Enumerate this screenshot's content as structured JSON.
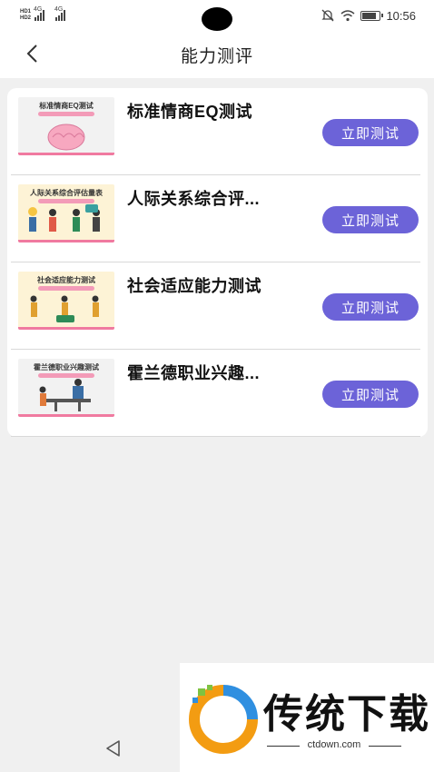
{
  "status_bar": {
    "net1": "HD1",
    "net2": "HD2",
    "sig1_label": "4G",
    "sig2_label": "4G",
    "time": "10:56",
    "battery_level": 0.8
  },
  "header": {
    "title": "能力测评",
    "back_icon": "chevron-left-icon"
  },
  "tests": [
    {
      "title": "标准情商EQ测试",
      "thumb_title": "标准情商EQ测试",
      "button": "立即测试",
      "thumb_bg": "#f2f2f2"
    },
    {
      "title": "人际关系综合评...",
      "thumb_title": "人际关系综合评估量表",
      "button": "立即测试",
      "thumb_bg": "#fdf3d6"
    },
    {
      "title": "社会适应能力测试",
      "thumb_title": "社会适应能力测试",
      "button": "立即测试",
      "thumb_bg": "#fdf3d6"
    },
    {
      "title": "霍兰德职业兴趣...",
      "thumb_title": "霍兰德职业兴趣测试",
      "button": "立即测试",
      "thumb_bg": "#f2f2f2"
    }
  ],
  "watermark": {
    "name": "传统下载",
    "url": "ctdown.com"
  },
  "colors": {
    "accent": "#6c63d8",
    "background": "#f0f0f0"
  }
}
